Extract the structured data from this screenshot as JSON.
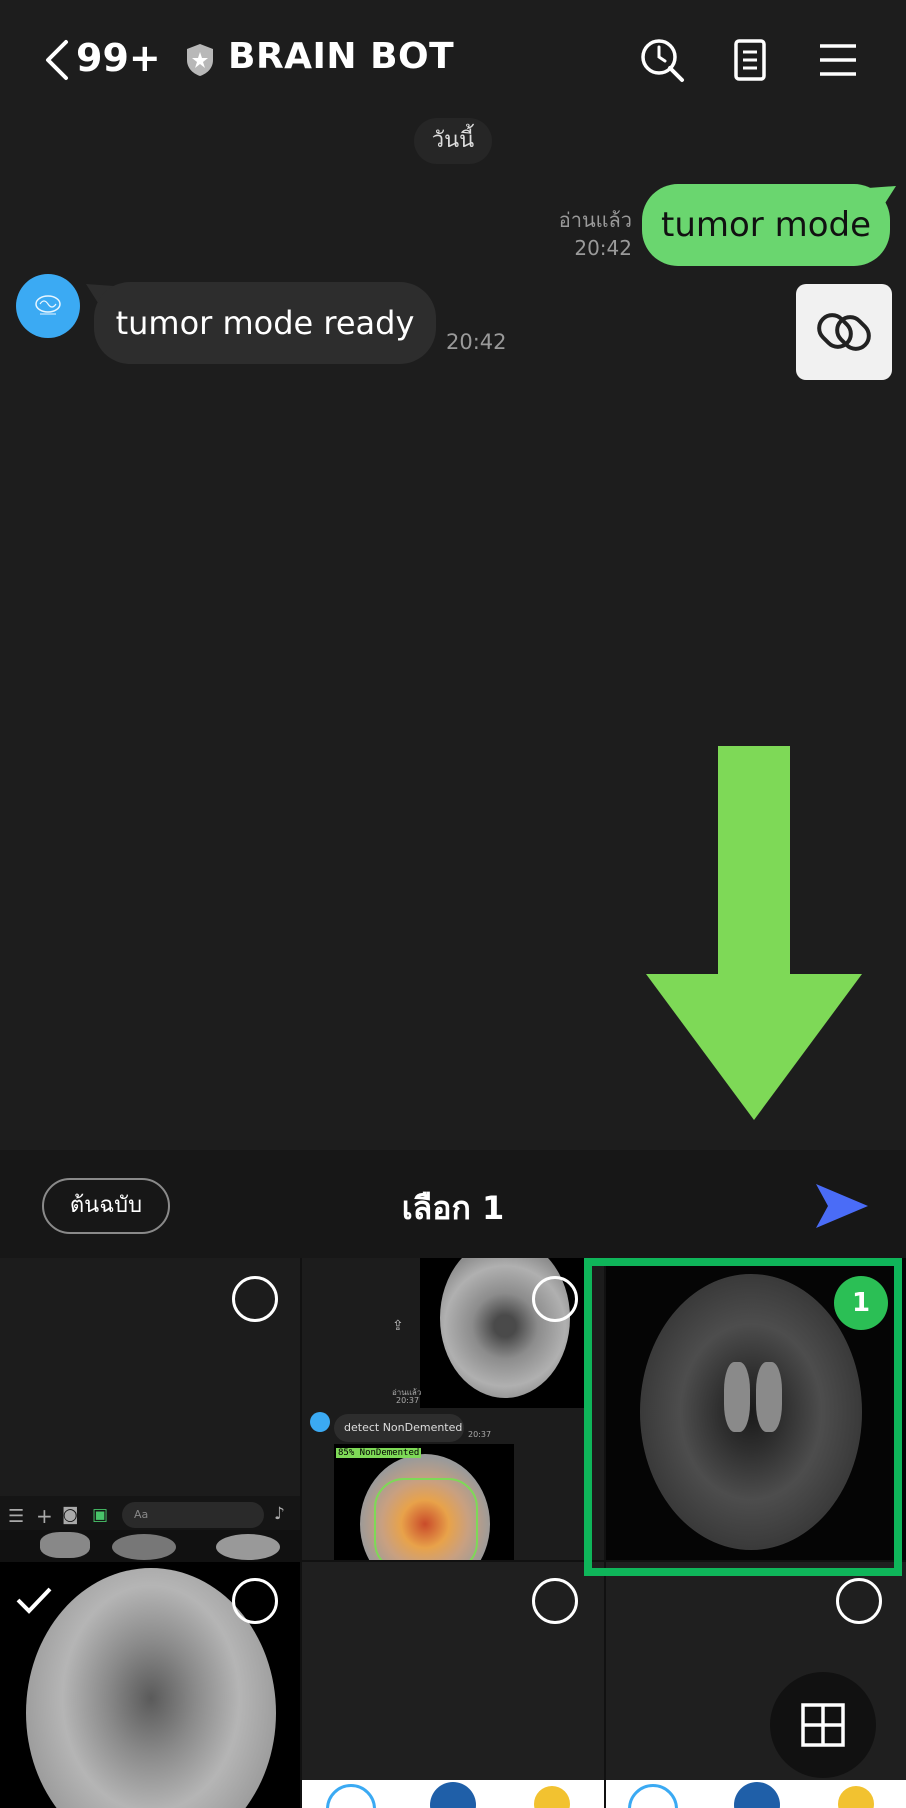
{
  "header": {
    "back_icon": "chevron-left-icon",
    "unread_count": "99+",
    "title": "BRAIN BOT",
    "icons": [
      "shield-icon",
      "clock-search-icon",
      "notes-icon",
      "menu-icon"
    ]
  },
  "chat": {
    "date_label": "วันนี้",
    "outgoing": {
      "text": "tumor mode",
      "read_label": "อ่านแล้ว",
      "time": "20:42"
    },
    "incoming": {
      "text": "tumor mode ready",
      "time": "20:42"
    }
  },
  "selection": {
    "original_label": "ต้นฉบับ",
    "count_label": "เลือก 1",
    "badge_number": "1"
  },
  "gallery": {
    "thumb_chat_read": "อ่านแล้ว",
    "thumb_chat_time": "20:37",
    "thumb_chat_text": "detect NonDemented",
    "thumb_chat_time2": "20:37",
    "thumb_label": "85% NonDemented",
    "thumb_input_placeholder": "Aa"
  },
  "colors": {
    "accent_green": "#6ad66f",
    "selection_green": "#0fb55a",
    "send_blue": "#4a6cf7",
    "arrow_green": "#7ed957"
  }
}
